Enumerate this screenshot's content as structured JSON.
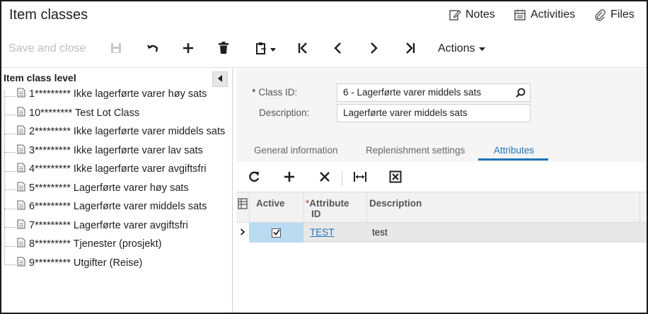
{
  "header": {
    "title": "Item classes",
    "links": [
      {
        "label": "Notes",
        "icon": "notes-icon"
      },
      {
        "label": "Activities",
        "icon": "calendar-icon"
      },
      {
        "label": "Files",
        "icon": "paperclip-icon"
      }
    ]
  },
  "toolbar": {
    "save_close_label": "Save and close",
    "actions_label": "Actions"
  },
  "tree": {
    "header": "Item class level",
    "items": [
      {
        "label": "1********* Ikke lagerførte varer høy sats"
      },
      {
        "label": "10******** Test Lot Class"
      },
      {
        "label": "2********* Ikke lagerførte varer middels sats"
      },
      {
        "label": "3********* Ikke lagerførte varer lav sats"
      },
      {
        "label": "4********* Ikke lagerførte varer avgiftsfri"
      },
      {
        "label": "5********* Lagerførte varer høy sats"
      },
      {
        "label": "6********* Lagerførte varer middels sats"
      },
      {
        "label": "7********* Lagerførte varer avgiftsfri"
      },
      {
        "label": "8********* Tjenester (prosjekt)"
      },
      {
        "label": "9********* Utgifter (Reise)"
      }
    ]
  },
  "form": {
    "class_id_label": "Class ID:",
    "class_id_value": "6 - Lagerførte varer middels sats",
    "description_label": "Description:",
    "description_value": "Lagerførte varer middels sats"
  },
  "tabs": [
    {
      "label": "General information"
    },
    {
      "label": "Replenishment settings"
    },
    {
      "label": "Attributes"
    }
  ],
  "grid": {
    "columns": {
      "active": "Active",
      "attribute_id_line1": "Attribute",
      "attribute_id_line2": "ID",
      "description": "Description"
    },
    "rows": [
      {
        "active": true,
        "attribute_id": "TEST",
        "description": "test"
      }
    ]
  },
  "colors": {
    "accent": "#1f74b8",
    "selected_cell": "#b9dcf3",
    "disabled_text": "#bdbdbd"
  }
}
